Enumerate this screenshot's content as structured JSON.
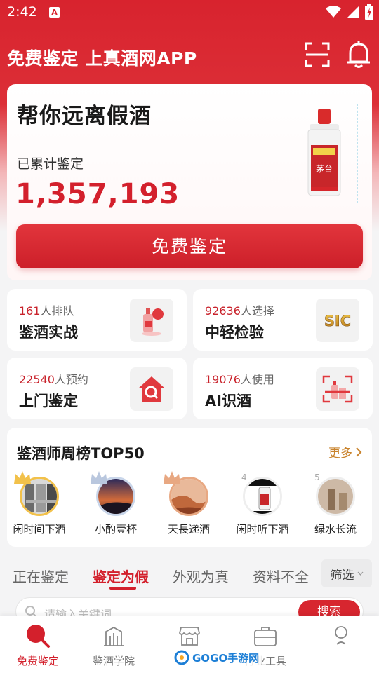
{
  "status_bar": {
    "time": "2:42",
    "notif_icon_letter": "A"
  },
  "header": {
    "title": "免费鉴定 上真酒网APP"
  },
  "hero": {
    "headline": "帮你远离假酒",
    "count_label": "已累计鉴定",
    "count": "1,357,193",
    "cta": "免费鉴定"
  },
  "features": [
    {
      "count": "161",
      "suffix": "人排队",
      "name": "鉴酒实战",
      "icon": "liquor-combat-icon"
    },
    {
      "count": "92636",
      "suffix": "人选择",
      "name": "中轻检验",
      "icon": "sic-logo",
      "logo_text": "SIC"
    },
    {
      "count": "22540",
      "suffix": "人预约",
      "name": "上门鉴定",
      "icon": "home-search-icon"
    },
    {
      "count": "19076",
      "suffix": "人使用",
      "name": "AI识酒",
      "icon": "ai-scan-bottle-icon"
    }
  ],
  "ranking": {
    "title": "鉴酒师周榜TOP50",
    "more": "更多",
    "judges": [
      {
        "name": "闲时间下酒",
        "rank": "1"
      },
      {
        "name": "小酌壹杯",
        "rank": "2"
      },
      {
        "name": "天長递酒",
        "rank": "3"
      },
      {
        "name": "闲时听下酒",
        "rank": "4"
      },
      {
        "name": "绿水长流",
        "rank": "5"
      }
    ]
  },
  "tabs": {
    "items": [
      "正在鉴定",
      "鉴定为假",
      "外观为真",
      "资料不全"
    ],
    "active": "鉴定为假",
    "filter": "筛选"
  },
  "search": {
    "placeholder": "请输入关键词",
    "button": "搜索"
  },
  "bottom_nav": [
    {
      "label": "免费鉴定",
      "icon": "search-red-icon",
      "active": true
    },
    {
      "label": "鉴酒学院",
      "icon": "building-icon",
      "active": false
    },
    {
      "label": "",
      "icon": "store-icon",
      "active": false
    },
    {
      "label": "行业工具",
      "icon": "briefcase-icon",
      "active": false
    },
    {
      "label": "",
      "icon": "user-icon",
      "active": false
    }
  ],
  "watermark": {
    "text": "GOGO手游网"
  },
  "colors": {
    "brand_red": "#d3202c",
    "gold": "#c9832c"
  }
}
